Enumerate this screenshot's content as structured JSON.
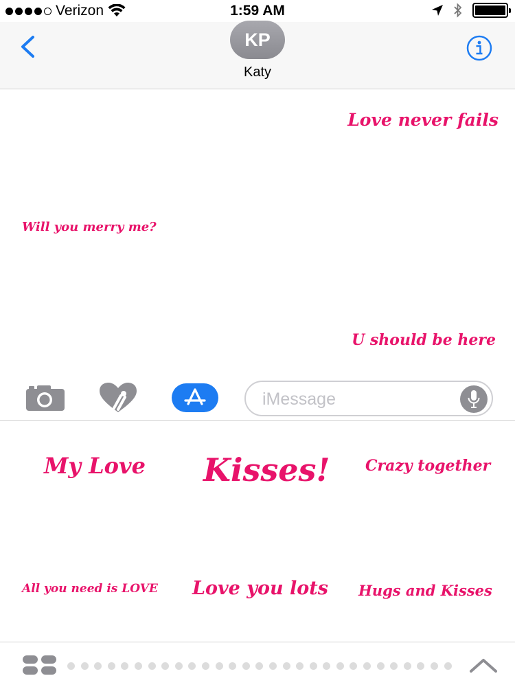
{
  "status_bar": {
    "carrier": "Verizon",
    "time": "1:59 AM",
    "signal_filled": 4,
    "signal_total": 5,
    "battery_level": 1.0,
    "icons": [
      "wifi-icon",
      "location-arrow-icon",
      "bluetooth-icon",
      "battery-icon"
    ]
  },
  "header": {
    "avatar_initials": "KP",
    "contact_name": "Katy",
    "icons": [
      "chevron-left-icon",
      "info-icon"
    ]
  },
  "conversation": {
    "messages": [
      {
        "text": "Love never fails"
      },
      {
        "text": "Will you merry me?"
      },
      {
        "text": "U should be here"
      }
    ],
    "sticker_color": "#e8136a"
  },
  "input_bar": {
    "placeholder": "iMessage",
    "icons": [
      "camera-icon",
      "digital-touch-heart-icon",
      "app-store-icon",
      "microphone-icon"
    ],
    "accent": "#1d7cf2"
  },
  "sticker_drawer": {
    "stickers": [
      {
        "text": "My Love"
      },
      {
        "text": "Kisses!"
      },
      {
        "text": "Crazy together"
      },
      {
        "text": "All you need is LOVE"
      },
      {
        "text": "Love  you lots"
      },
      {
        "text": "Hugs and Kisses"
      }
    ]
  },
  "bottom_bar": {
    "page_dot_count": 29,
    "icons": [
      "app-drawer-icon",
      "chevron-up-icon"
    ]
  }
}
